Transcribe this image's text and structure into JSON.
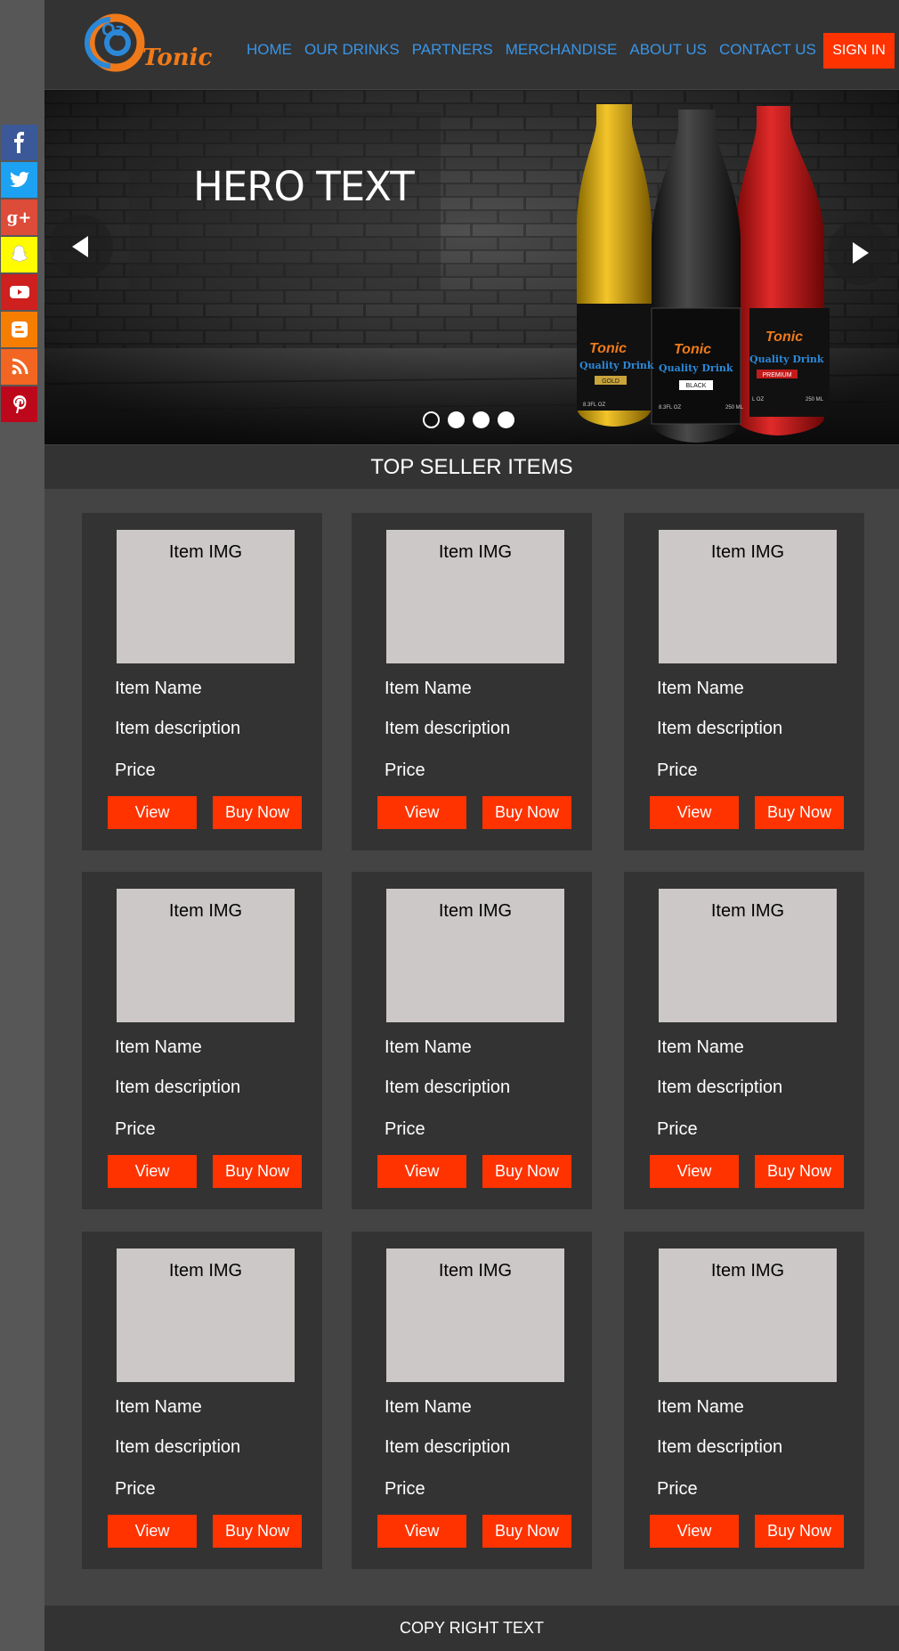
{
  "brand": {
    "logo_prefix": "Oz",
    "logo_name": "Tonic"
  },
  "nav": {
    "items": [
      "HOME",
      "OUR DRINKS",
      "PARTNERS",
      "MERCHANDISE",
      "ABOUT US",
      "CONTACT US"
    ],
    "signin_label": "SIGN IN"
  },
  "hero": {
    "title": "HERO TEXT",
    "bottles": [
      {
        "brand": "Tonic",
        "tagline": "Quality Drink",
        "variant": "GOLD",
        "volume_left": "8.3FL OZ",
        "volume_right": "250 ML"
      },
      {
        "brand": "Tonic",
        "tagline": "Quality Drink",
        "variant": "BLACK",
        "volume_left": "8.3FL OZ",
        "volume_right": "250 ML"
      },
      {
        "brand": "Tonic",
        "tagline": "Quality Drink",
        "variant": "PREMIUM",
        "volume_left": "L OZ",
        "volume_right": "250 ML"
      }
    ],
    "slide_count": 4,
    "active_slide": 1
  },
  "social": [
    "facebook-icon",
    "twitter-icon",
    "google-plus-icon",
    "snapchat-icon",
    "youtube-icon",
    "blogger-icon",
    "rss-icon",
    "pinterest-icon"
  ],
  "section": {
    "title": "TOP SELLER ITEMS"
  },
  "items": [
    {
      "img": "Item IMG",
      "name": "Item Name",
      "description": "Item description",
      "price": "Price",
      "view": "View",
      "buy": "Buy Now"
    },
    {
      "img": "Item IMG",
      "name": "Item Name",
      "description": "Item description",
      "price": "Price",
      "view": "View",
      "buy": "Buy Now"
    },
    {
      "img": "Item IMG",
      "name": "Item Name",
      "description": "Item description",
      "price": "Price",
      "view": "View",
      "buy": "Buy Now"
    },
    {
      "img": "Item IMG",
      "name": "Item Name",
      "description": "Item description",
      "price": "Price",
      "view": "View",
      "buy": "Buy Now"
    },
    {
      "img": "Item IMG",
      "name": "Item Name",
      "description": "Item description",
      "price": "Price",
      "view": "View",
      "buy": "Buy Now"
    },
    {
      "img": "Item IMG",
      "name": "Item Name",
      "description": "Item description",
      "price": "Price",
      "view": "View",
      "buy": "Buy Now"
    },
    {
      "img": "Item IMG",
      "name": "Item Name",
      "description": "Item description",
      "price": "Price",
      "view": "View",
      "buy": "Buy Now"
    },
    {
      "img": "Item IMG",
      "name": "Item Name",
      "description": "Item description",
      "price": "Price",
      "view": "View",
      "buy": "Buy Now"
    },
    {
      "img": "Item IMG",
      "name": "Item Name",
      "description": "Item description",
      "price": "Price",
      "view": "View",
      "buy": "Buy Now"
    }
  ],
  "footer": {
    "copyright": "COPY RIGHT TEXT"
  },
  "colors": {
    "accent": "#ff3300",
    "nav_link": "#3a95e8",
    "bar": "#333333",
    "page": "#444444",
    "card_img": "#cdc8c8"
  }
}
